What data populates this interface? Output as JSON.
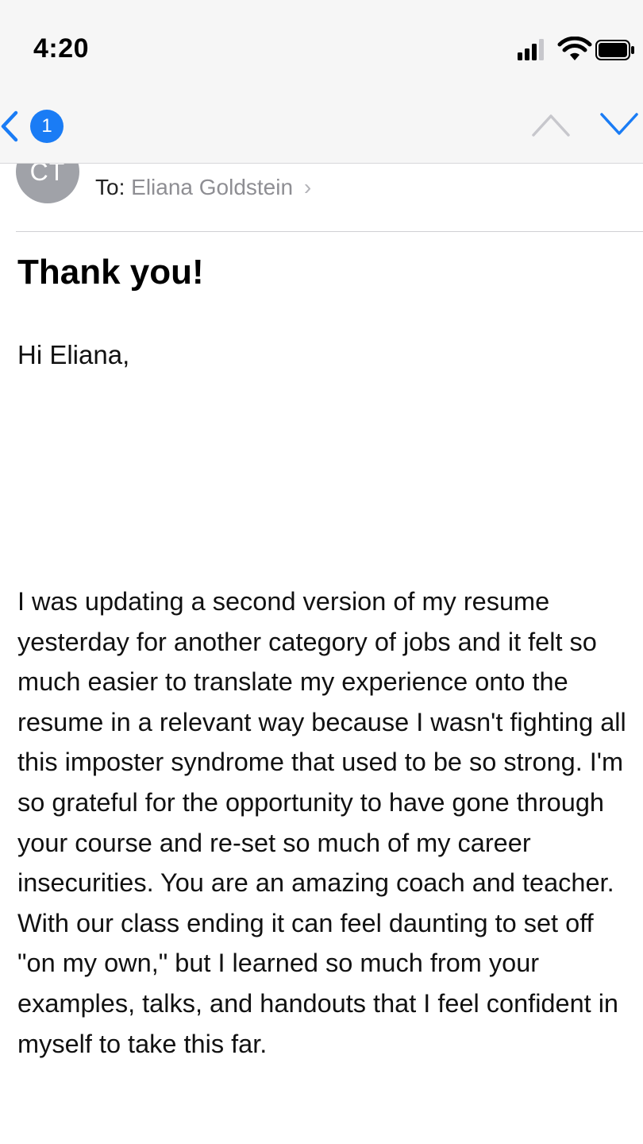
{
  "status_bar": {
    "time": "4:20",
    "icons": [
      "signal-icon",
      "wifi-icon",
      "battery-icon"
    ]
  },
  "nav": {
    "back_icon": "chevron-left-icon",
    "badge_count": "1",
    "prev_icon": "chevron-up-icon",
    "next_icon": "chevron-down-icon",
    "accent_color": "#1a7cf5"
  },
  "message": {
    "avatar_initials": "CT",
    "to_label": "To:",
    "recipient": "Eliana Goldstein",
    "subject": "Thank you!",
    "greeting": "Hi Eliana,",
    "body": "I was updating a second version of my resume yesterday for another category of jobs and it felt so much easier to translate my experience onto the resume in a relevant way because I wasn't fighting all this imposter syndrome that used to be so strong. I'm so grateful for the opportunity to have gone through your course and re-set so much of my career insecurities. You are an amazing coach and teacher. With our class ending it can feel daunting to set off \"on my own,\" but I learned so much from your examples, talks, and handouts that I feel confident in myself to take this far."
  }
}
